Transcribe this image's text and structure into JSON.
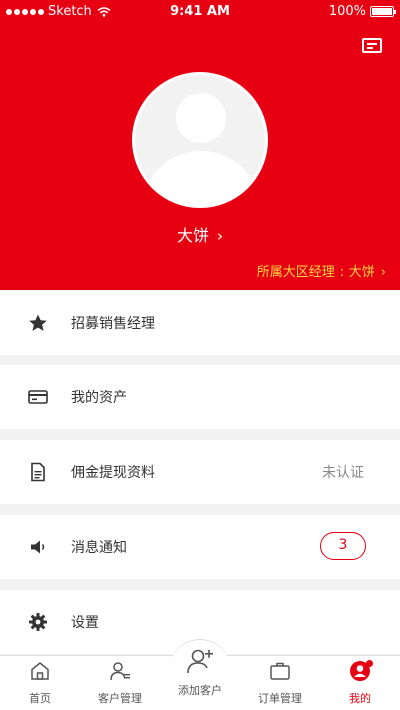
{
  "status_bar": {
    "carrier": "Sketch",
    "time": "9:41 AM",
    "battery": "100%"
  },
  "header": {
    "card_icon": "id-card-icon",
    "avatar_icon": "default-avatar",
    "user_name": "大饼",
    "user_chevron": "›",
    "manager_label": "所属大区经理",
    "manager_sep": ":",
    "manager_name": "大饼",
    "manager_chevron": "›"
  },
  "colors": {
    "brand_red": "#e60012",
    "manager_yellow": "#ffd740"
  },
  "menu": {
    "items": [
      {
        "icon": "star-icon",
        "label": "招募销售经理"
      },
      {
        "icon": "credit-card-icon",
        "label": "我的资产"
      },
      {
        "icon": "document-icon",
        "label": "佣金提现资料",
        "value": "未认证"
      },
      {
        "icon": "speaker-icon",
        "label": "消息通知",
        "badge": "3"
      },
      {
        "icon": "gear-icon",
        "label": "设置"
      }
    ]
  },
  "tabbar": {
    "tabs": [
      {
        "icon": "home-icon",
        "label": "首页"
      },
      {
        "icon": "customer-icon",
        "label": "客户管理"
      },
      {
        "icon": "add-customer-icon",
        "label": "添加客户"
      },
      {
        "icon": "briefcase-icon",
        "label": "订单管理"
      },
      {
        "icon": "profile-icon",
        "label": "我的",
        "active": true
      }
    ]
  }
}
